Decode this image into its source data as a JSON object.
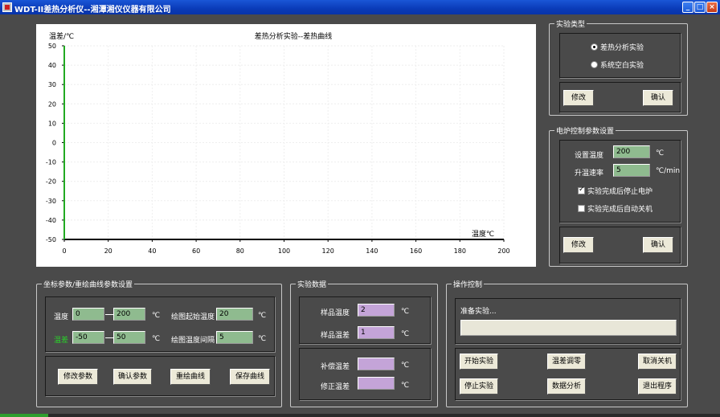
{
  "window": {
    "title": "WDT-II差热分析仪--湘潭湘仪仪器有限公司"
  },
  "chart_data": {
    "type": "line",
    "title": "差热分析实验--差热曲线",
    "ylabel": "温差/℃",
    "xlabel": "温度℃",
    "xlim": [
      0,
      200
    ],
    "ylim": [
      -50,
      50
    ],
    "xticks": [
      "0",
      "20",
      "40",
      "60",
      "80",
      "100",
      "120",
      "140",
      "160",
      "180",
      "200"
    ],
    "yticks": [
      "50",
      "40",
      "30",
      "20",
      "10",
      "0",
      "-10",
      "-20",
      "-30",
      "-40",
      "-50"
    ],
    "grid": true,
    "series": []
  },
  "experiment_type": {
    "legend": "实验类型",
    "options": [
      "差热分析实验",
      "系统空白实验"
    ],
    "selected": 0,
    "modify": "修改",
    "confirm": "确认"
  },
  "furnace": {
    "legend": "电炉控制参数设置",
    "set_temp_label": "设置温度",
    "set_temp_value": "200",
    "set_temp_unit": "℃",
    "rate_label": "升温速率",
    "rate_value": "5",
    "rate_unit": "℃/min",
    "stop_heater_label": "实验完成后停止电炉",
    "stop_heater_checked": true,
    "auto_shutdown_label": "实验完成后自动关机",
    "auto_shutdown_checked": false,
    "modify": "修改",
    "confirm": "确认"
  },
  "coord": {
    "legend": "坐标参数/重绘曲线参数设置",
    "temp_label": "温度",
    "temp_min": "0",
    "temp_max": "200",
    "temp_unit": "℃",
    "diff_label": "温差",
    "diff_min": "-50",
    "diff_max": "50",
    "diff_unit": "℃",
    "start_temp_label": "绘图起始温度",
    "start_temp_value": "20",
    "start_temp_unit": "℃",
    "interval_label": "绘图温度间隔",
    "interval_value": "5",
    "interval_unit": "℃",
    "buttons": [
      "修改参数",
      "确认参数",
      "重绘曲线",
      "保存曲线"
    ]
  },
  "exp_data": {
    "legend": "实验数据",
    "sample_temp_label": "样品温度",
    "sample_temp_value": "2",
    "sample_diff_label": "样品温差",
    "sample_diff_value": "1",
    "comp_diff_label": "补偿温差",
    "comp_diff_value": "",
    "corr_diff_label": "修正温差",
    "corr_diff_value": "",
    "unit": "℃"
  },
  "ops": {
    "legend": "操作控制",
    "status": "准备实验...",
    "buttons": [
      "开始实验",
      "温差调零",
      "取消关机",
      "停止实验",
      "数据分析",
      "退出程序"
    ]
  }
}
